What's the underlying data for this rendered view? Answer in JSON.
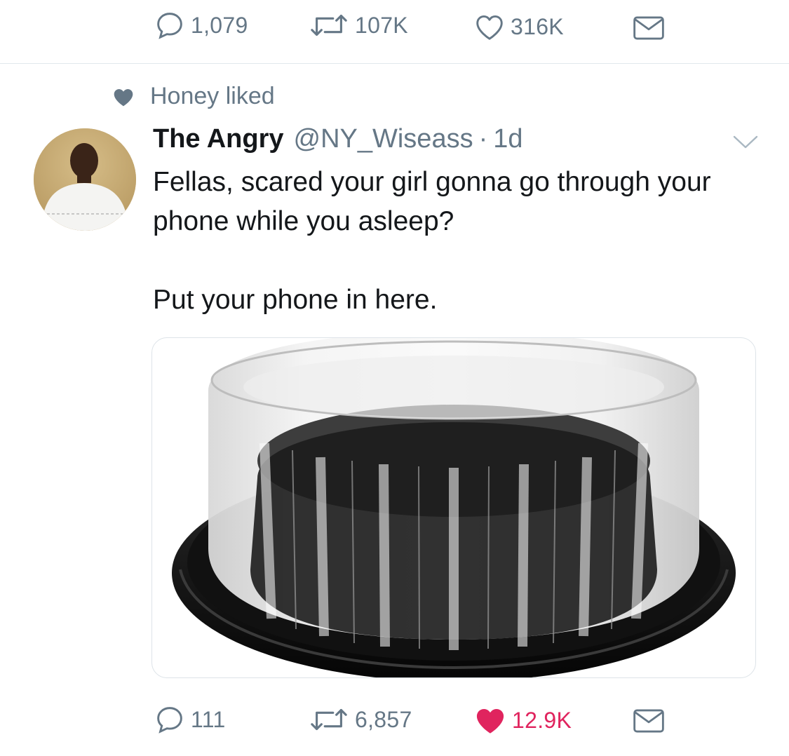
{
  "prev_tweet_actions": {
    "reply_count": "1,079",
    "retweet_count": "107K",
    "like_count": "316K"
  },
  "social_context": {
    "text": "Honey liked"
  },
  "tweet": {
    "display_name": "The Angry",
    "handle": "@NY_Wiseass",
    "separator": "·",
    "time": "1d",
    "text_line1": "Fellas, scared your girl gonna go through your phone while you asleep?",
    "text_line2": "Put your phone in here.",
    "media_description": "clear plastic cake dome container with black base"
  },
  "actions": {
    "reply_count": "111",
    "retweet_count": "6,857",
    "like_count": "12.9K",
    "liked": true
  },
  "colors": {
    "muted": "#657786",
    "like_active": "#e0245e",
    "text": "#14171a",
    "divider": "#e1e8ed"
  },
  "icons": [
    "reply-icon",
    "retweet-icon",
    "like-icon",
    "dm-icon",
    "heart-small-icon",
    "caret-down-icon"
  ]
}
